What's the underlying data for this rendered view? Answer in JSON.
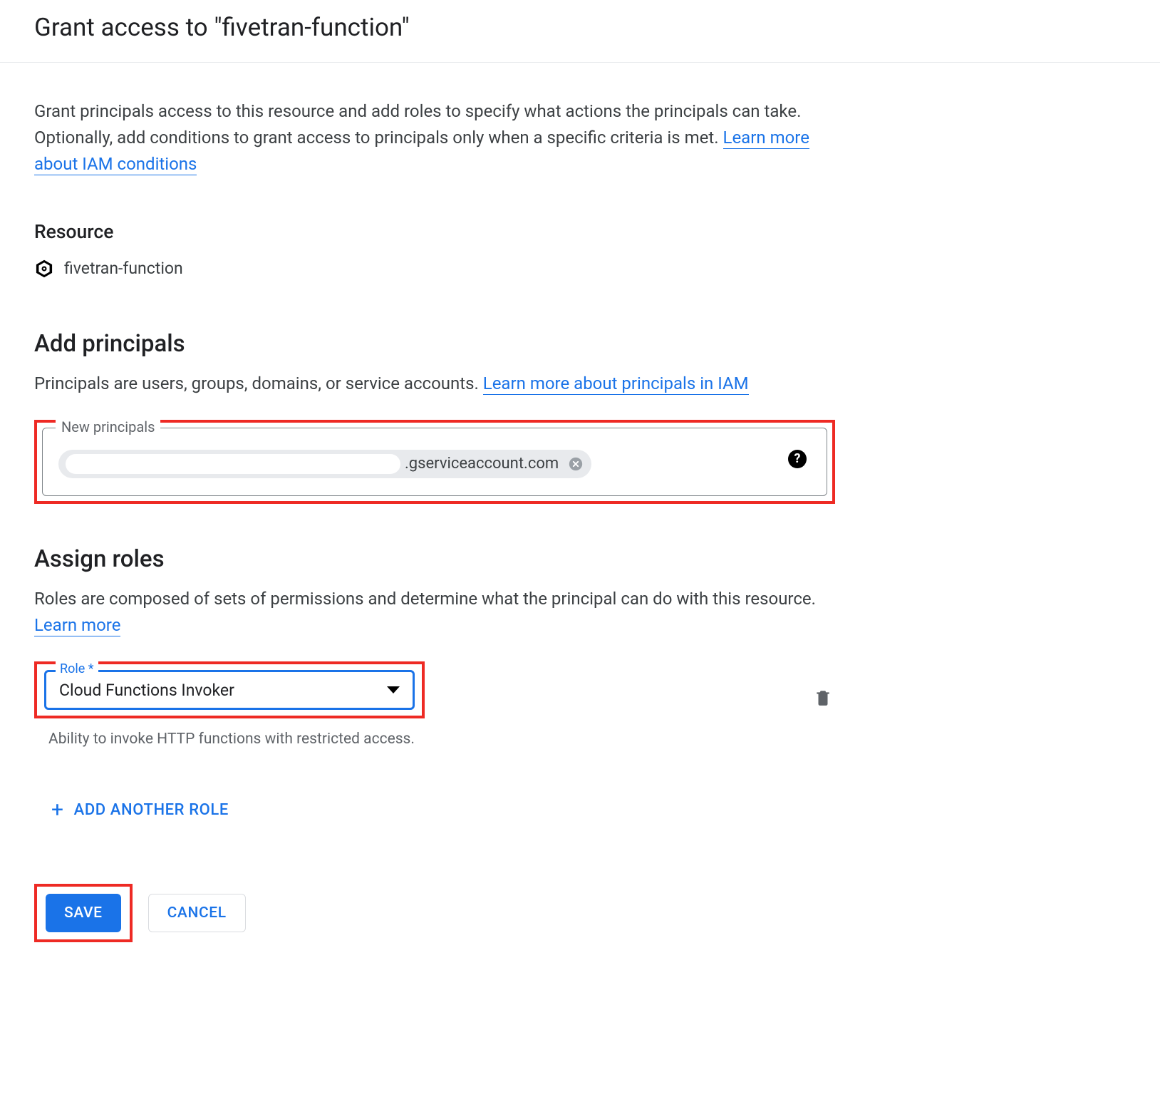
{
  "header": {
    "title": "Grant access to \"fivetran-function\""
  },
  "intro": {
    "text_before_link": "Grant principals access to this resource and add roles to specify what actions the principals can take. Optionally, add conditions to grant access to principals only when a specific criteria is met. ",
    "link_text": "Learn more about IAM conditions"
  },
  "resource": {
    "heading": "Resource",
    "name": "fivetran-function"
  },
  "principals": {
    "heading": "Add principals",
    "desc_before_link": "Principals are users, groups, domains, or service accounts. ",
    "link_text": "Learn more about principals in IAM",
    "field_label": "New principals",
    "chip_suffix": ".gserviceaccount.com"
  },
  "roles": {
    "heading": "Assign roles",
    "desc_before_link": "Roles are composed of sets of permissions and determine what the principal can do with this resource. ",
    "link_text": "Learn more",
    "field_label": "Role *",
    "selected": "Cloud Functions Invoker",
    "role_description": "Ability to invoke HTTP functions with restricted access.",
    "add_another": "ADD ANOTHER ROLE"
  },
  "buttons": {
    "save": "SAVE",
    "cancel": "CANCEL"
  }
}
